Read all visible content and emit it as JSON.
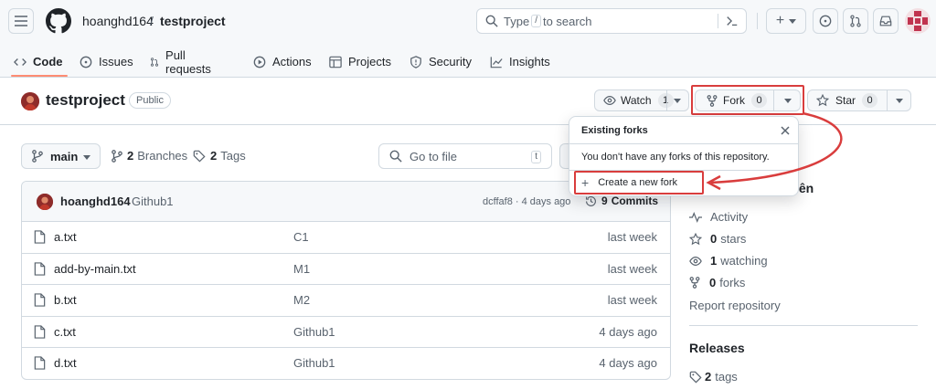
{
  "header": {
    "owner": "hoanghd164",
    "separator": "/",
    "repo": "testproject",
    "search_prefix": "Type",
    "search_key": "/",
    "search_suffix": "to search",
    "command_icon": "terminal-icon",
    "create_label": "+"
  },
  "tabs": [
    {
      "label": "Code",
      "icon": "code-icon",
      "active": true
    },
    {
      "label": "Issues",
      "icon": "issue-opened-icon"
    },
    {
      "label": "Pull requests",
      "icon": "git-pull-request-icon"
    },
    {
      "label": "Actions",
      "icon": "play-icon"
    },
    {
      "label": "Projects",
      "icon": "table-icon"
    },
    {
      "label": "Security",
      "icon": "shield-icon"
    },
    {
      "label": "Insights",
      "icon": "graph-icon"
    }
  ],
  "repo": {
    "name": "testproject",
    "visibility": "Public",
    "watch_label": "Watch",
    "watch_count": "1",
    "fork_label": "Fork",
    "fork_count": "0",
    "star_label": "Star",
    "star_count": "0"
  },
  "branch": {
    "current": "main",
    "branches_count": "2",
    "branches_label": "Branches",
    "tags_count": "2",
    "tags_label": "Tags",
    "goto_placeholder": "Go to file",
    "goto_key": "t"
  },
  "commit": {
    "author": "hoanghd164",
    "message": "Github1",
    "hash_time": "dcffaf8 · 4 days ago",
    "commits_count": "9",
    "commits_label": "Commits"
  },
  "files": [
    {
      "name": "a.txt",
      "message": "C1",
      "time": "last week"
    },
    {
      "name": "add-by-main.txt",
      "message": "M1",
      "time": "last week"
    },
    {
      "name": "b.txt",
      "message": "M2",
      "time": "last week"
    },
    {
      "name": "c.txt",
      "message": "Github1",
      "time": "4 days ago"
    },
    {
      "name": "d.txt",
      "message": "Github1",
      "time": "4 days ago"
    }
  ],
  "sidebar": {
    "about_fragment": "iên",
    "activity": "Activity",
    "stars_count": "0",
    "stars_label": "stars",
    "watching_count": "1",
    "watching_label": "watching",
    "forks_count": "0",
    "forks_label": "forks",
    "report": "Report repository",
    "releases_title": "Releases",
    "tags_count": "2",
    "tags_label": "tags"
  },
  "dropdown": {
    "title": "Existing forks",
    "empty_text": "You don't have any forks of this repository.",
    "create_label": "Create a new fork"
  },
  "colors": {
    "annotation_red": "#d93d3d",
    "tab_underline": "#fd8c73"
  }
}
